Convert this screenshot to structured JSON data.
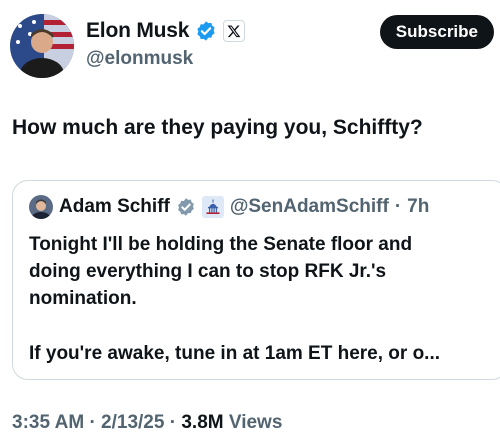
{
  "author": {
    "display_name": "Elon Musk",
    "handle": "@elonmusk"
  },
  "header": {
    "subscribe_label": "Subscribe"
  },
  "tweet": {
    "text": "How much are they paying you, Schiffty?"
  },
  "quoted_tweet": {
    "display_name": "Adam Schiff",
    "handle": "@SenAdamSchiff",
    "separator": "·",
    "time": "7h",
    "lines": [
      "Tonight I'll be holding the Senate floor and",
      "doing everything I can to stop RFK Jr.'s",
      "nomination."
    ],
    "paragraph2": "If you're awake, tune in at 1am ET here, or o..."
  },
  "meta": {
    "time": "3:35 AM",
    "sep1": "·",
    "date": "2/13/25",
    "sep2": "·",
    "views_count": "3.8M",
    "views_label": "Views"
  },
  "colors": {
    "verified_blue": "#1d9bf0",
    "government_gray": "#829aab",
    "text_primary": "#0f1419",
    "text_secondary": "#536471",
    "border": "#cfd9de"
  },
  "icons": {
    "verified": "verified-badge-icon",
    "x_affiliation": "x-logo-icon",
    "government": "government-verified-icon",
    "capitol": "us-capitol-icon"
  }
}
